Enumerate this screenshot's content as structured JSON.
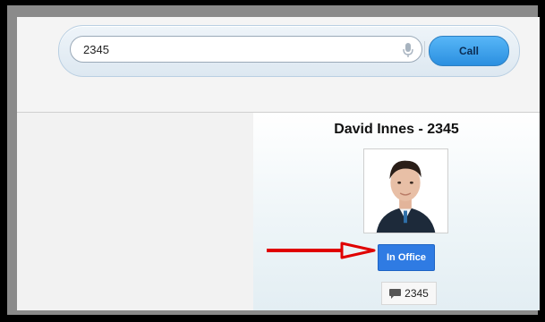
{
  "search": {
    "value": "2345",
    "mic_icon": "microphone-icon",
    "call_label": "Call"
  },
  "contact": {
    "name": "David Innes - 2345",
    "photo_icon": "person-photo",
    "status_label": "In Office",
    "extension_icon": "chat-bubble-icon",
    "extension": "2345"
  },
  "annotation": {
    "arrow_color": "#e00000"
  },
  "colors": {
    "call_button": "#2b8fe0",
    "status_button": "#2f7be3"
  }
}
